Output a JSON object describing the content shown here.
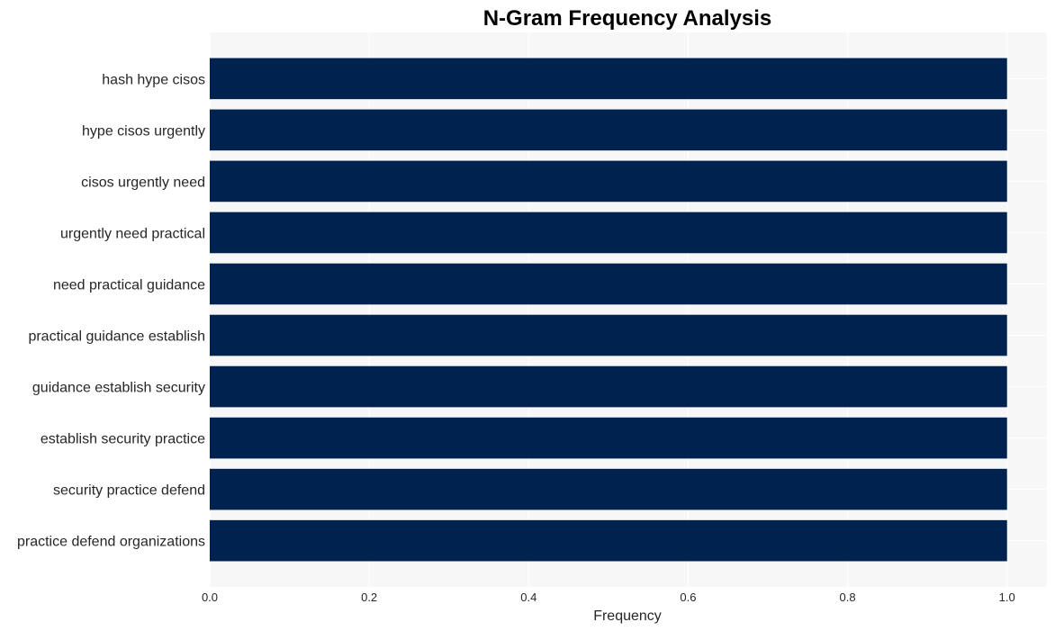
{
  "chart_data": {
    "type": "bar",
    "orientation": "horizontal",
    "title": "N-Gram Frequency Analysis",
    "xlabel": "Frequency",
    "ylabel": "",
    "xlim": [
      0,
      1.05
    ],
    "xticks": [
      0.0,
      0.2,
      0.4,
      0.6,
      0.8,
      1.0
    ],
    "xtick_labels": [
      "0.0",
      "0.2",
      "0.4",
      "0.6",
      "0.8",
      "1.0"
    ],
    "grid": true,
    "legend": "none",
    "bar_color": "#00224e",
    "background_color": "#f7f7f7",
    "grid_color": "#ffffff",
    "categories": [
      "hash hype cisos",
      "hype cisos urgently",
      "cisos urgently need",
      "urgently need practical",
      "need practical guidance",
      "practical guidance establish",
      "guidance establish security",
      "establish security practice",
      "security practice defend",
      "practice defend organizations"
    ],
    "values": [
      1,
      1,
      1,
      1,
      1,
      1,
      1,
      1,
      1,
      1
    ]
  }
}
